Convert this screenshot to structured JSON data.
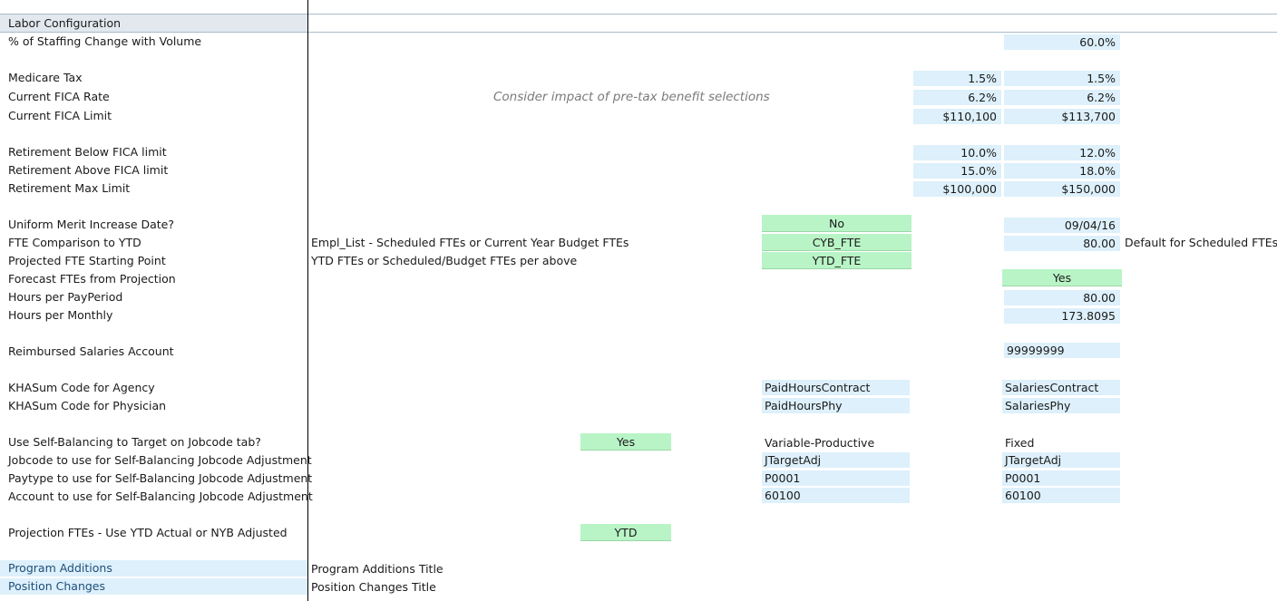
{
  "section_title": "Labor Configuration",
  "rows": {
    "staffing_change": {
      "label": "% of Staffing Change with Volume",
      "value": "60.0%"
    },
    "medicare": {
      "label": "Medicare Tax",
      "value_a": "1.5%",
      "value_b": "1.5%"
    },
    "fica_rate": {
      "label": "Current FICA Rate",
      "value_a": "6.2%",
      "value_b": "6.2%"
    },
    "fica_limit": {
      "label": "Current FICA Limit",
      "value_a": "$110,100",
      "value_b": "$113,700"
    },
    "ret_below": {
      "label": "Retirement Below FICA limit",
      "value_a": "10.0%",
      "value_b": "12.0%"
    },
    "ret_above": {
      "label": "Retirement Above FICA limit",
      "value_a": "15.0%",
      "value_b": "18.0%"
    },
    "ret_max": {
      "label": "Retirement Max Limit",
      "value_a": "$100,000",
      "value_b": "$150,000"
    },
    "merit_date": {
      "label": "Uniform Merit Increase Date?",
      "option": "No",
      "value": "09/04/16"
    },
    "fte_compare": {
      "label": "FTE Comparison to YTD",
      "note": "Empl_List - Scheduled FTEs or Current Year Budget FTEs",
      "option": "CYB_FTE",
      "value": "80.00",
      "note2": "Default for Scheduled FTEs"
    },
    "fte_start": {
      "label": "Projected FTE Starting Point",
      "note": "YTD FTEs or Scheduled/Budget FTEs per above",
      "option": "YTD_FTE"
    },
    "forecast_fte": {
      "label": "Forecast FTEs from Projection",
      "option": "Yes"
    },
    "hours_pay": {
      "label": "Hours per PayPeriod",
      "value": "80.00"
    },
    "hours_month": {
      "label": "Hours per Monthly",
      "value": "173.8095"
    },
    "reimbursed": {
      "label": "Reimbursed Salaries Account",
      "value": "99999999"
    },
    "khasum_agency": {
      "label": "KHASum Code for Agency",
      "value_a": "PaidHoursContract",
      "value_b": "SalariesContract"
    },
    "khasum_phys": {
      "label": "KHASum Code for Physician",
      "value_a": "PaidHoursPhy",
      "value_b": "SalariesPhy"
    },
    "self_bal": {
      "label": "Use Self-Balancing to Target on Jobcode tab?",
      "option": "Yes",
      "value_a": "Variable-Productive",
      "value_b": "Fixed"
    },
    "jobcode_adj": {
      "label": "Jobcode to use for Self-Balancing Jobcode Adjustment",
      "value_a": "JTargetAdj",
      "value_b": "JTargetAdj"
    },
    "paytype_adj": {
      "label": "Paytype to use for Self-Balancing Jobcode Adjustment",
      "value_a": "P0001",
      "value_b": "P0001"
    },
    "account_adj": {
      "label": "Account to use for Self-Balancing Jobcode Adjustment",
      "value_a": "60100",
      "value_b": "60100"
    },
    "proj_fte": {
      "label": "Projection FTEs - Use YTD Actual or NYB Adjusted",
      "option": "YTD"
    },
    "program_add": {
      "label": "Program Additions",
      "note": "Program Additions Title"
    },
    "position_chg": {
      "label": "Position Changes",
      "note": "Position Changes Title"
    }
  },
  "fica_note": "Consider impact of pre-tax benefit selections",
  "colors": {
    "input_blue": "#ddf0fb",
    "option_green": "#b9f4c6"
  }
}
